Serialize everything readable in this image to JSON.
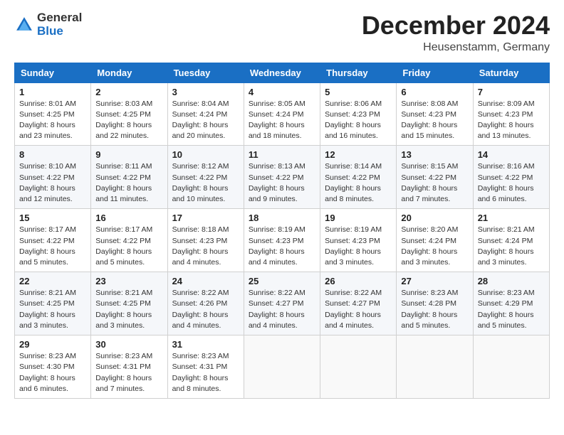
{
  "logo": {
    "general": "General",
    "blue": "Blue"
  },
  "title": "December 2024",
  "location": "Heusenstamm, Germany",
  "days_of_week": [
    "Sunday",
    "Monday",
    "Tuesday",
    "Wednesday",
    "Thursday",
    "Friday",
    "Saturday"
  ],
  "weeks": [
    [
      {
        "day": "1",
        "sunrise": "8:01 AM",
        "sunset": "4:25 PM",
        "daylight": "8 hours and 23 minutes."
      },
      {
        "day": "2",
        "sunrise": "8:03 AM",
        "sunset": "4:25 PM",
        "daylight": "8 hours and 22 minutes."
      },
      {
        "day": "3",
        "sunrise": "8:04 AM",
        "sunset": "4:24 PM",
        "daylight": "8 hours and 20 minutes."
      },
      {
        "day": "4",
        "sunrise": "8:05 AM",
        "sunset": "4:24 PM",
        "daylight": "8 hours and 18 minutes."
      },
      {
        "day": "5",
        "sunrise": "8:06 AM",
        "sunset": "4:23 PM",
        "daylight": "8 hours and 16 minutes."
      },
      {
        "day": "6",
        "sunrise": "8:08 AM",
        "sunset": "4:23 PM",
        "daylight": "8 hours and 15 minutes."
      },
      {
        "day": "7",
        "sunrise": "8:09 AM",
        "sunset": "4:23 PM",
        "daylight": "8 hours and 13 minutes."
      }
    ],
    [
      {
        "day": "8",
        "sunrise": "8:10 AM",
        "sunset": "4:22 PM",
        "daylight": "8 hours and 12 minutes."
      },
      {
        "day": "9",
        "sunrise": "8:11 AM",
        "sunset": "4:22 PM",
        "daylight": "8 hours and 11 minutes."
      },
      {
        "day": "10",
        "sunrise": "8:12 AM",
        "sunset": "4:22 PM",
        "daylight": "8 hours and 10 minutes."
      },
      {
        "day": "11",
        "sunrise": "8:13 AM",
        "sunset": "4:22 PM",
        "daylight": "8 hours and 9 minutes."
      },
      {
        "day": "12",
        "sunrise": "8:14 AM",
        "sunset": "4:22 PM",
        "daylight": "8 hours and 8 minutes."
      },
      {
        "day": "13",
        "sunrise": "8:15 AM",
        "sunset": "4:22 PM",
        "daylight": "8 hours and 7 minutes."
      },
      {
        "day": "14",
        "sunrise": "8:16 AM",
        "sunset": "4:22 PM",
        "daylight": "8 hours and 6 minutes."
      }
    ],
    [
      {
        "day": "15",
        "sunrise": "8:17 AM",
        "sunset": "4:22 PM",
        "daylight": "8 hours and 5 minutes."
      },
      {
        "day": "16",
        "sunrise": "8:17 AM",
        "sunset": "4:22 PM",
        "daylight": "8 hours and 5 minutes."
      },
      {
        "day": "17",
        "sunrise": "8:18 AM",
        "sunset": "4:23 PM",
        "daylight": "8 hours and 4 minutes."
      },
      {
        "day": "18",
        "sunrise": "8:19 AM",
        "sunset": "4:23 PM",
        "daylight": "8 hours and 4 minutes."
      },
      {
        "day": "19",
        "sunrise": "8:19 AM",
        "sunset": "4:23 PM",
        "daylight": "8 hours and 3 minutes."
      },
      {
        "day": "20",
        "sunrise": "8:20 AM",
        "sunset": "4:24 PM",
        "daylight": "8 hours and 3 minutes."
      },
      {
        "day": "21",
        "sunrise": "8:21 AM",
        "sunset": "4:24 PM",
        "daylight": "8 hours and 3 minutes."
      }
    ],
    [
      {
        "day": "22",
        "sunrise": "8:21 AM",
        "sunset": "4:25 PM",
        "daylight": "8 hours and 3 minutes."
      },
      {
        "day": "23",
        "sunrise": "8:21 AM",
        "sunset": "4:25 PM",
        "daylight": "8 hours and 3 minutes."
      },
      {
        "day": "24",
        "sunrise": "8:22 AM",
        "sunset": "4:26 PM",
        "daylight": "8 hours and 4 minutes."
      },
      {
        "day": "25",
        "sunrise": "8:22 AM",
        "sunset": "4:27 PM",
        "daylight": "8 hours and 4 minutes."
      },
      {
        "day": "26",
        "sunrise": "8:22 AM",
        "sunset": "4:27 PM",
        "daylight": "8 hours and 4 minutes."
      },
      {
        "day": "27",
        "sunrise": "8:23 AM",
        "sunset": "4:28 PM",
        "daylight": "8 hours and 5 minutes."
      },
      {
        "day": "28",
        "sunrise": "8:23 AM",
        "sunset": "4:29 PM",
        "daylight": "8 hours and 5 minutes."
      }
    ],
    [
      {
        "day": "29",
        "sunrise": "8:23 AM",
        "sunset": "4:30 PM",
        "daylight": "8 hours and 6 minutes."
      },
      {
        "day": "30",
        "sunrise": "8:23 AM",
        "sunset": "4:31 PM",
        "daylight": "8 hours and 7 minutes."
      },
      {
        "day": "31",
        "sunrise": "8:23 AM",
        "sunset": "4:31 PM",
        "daylight": "8 hours and 8 minutes."
      },
      null,
      null,
      null,
      null
    ]
  ],
  "labels": {
    "sunrise": "Sunrise:",
    "sunset": "Sunset:",
    "daylight": "Daylight:"
  }
}
